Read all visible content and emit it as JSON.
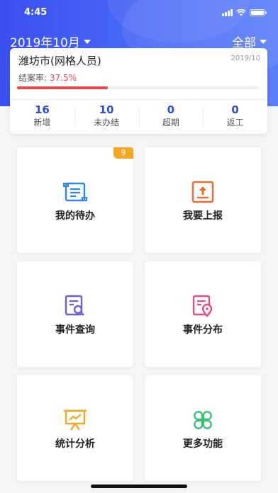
{
  "status_bar": {
    "time": "4:45"
  },
  "header": {
    "month": "2019年10月",
    "scope": "全部"
  },
  "summary": {
    "title": "潍坊市(网格人员)",
    "date": "2019/10",
    "rate_label": "结案率:",
    "rate_value": "37.5%",
    "rate_fraction": 0.375,
    "stats": [
      {
        "value": "16",
        "label": "新增"
      },
      {
        "value": "10",
        "label": "未办结"
      },
      {
        "value": "0",
        "label": "超期"
      },
      {
        "value": "0",
        "label": "返工"
      }
    ]
  },
  "tiles": [
    {
      "label": "我的待办",
      "icon": "scroll-list-icon",
      "color": "#2f86e8",
      "badge": "9"
    },
    {
      "label": "我要上报",
      "icon": "upload-icon",
      "color": "#ef6c2f"
    },
    {
      "label": "事件查询",
      "icon": "document-search-icon",
      "color": "#6b5cd8"
    },
    {
      "label": "事件分布",
      "icon": "document-location-icon",
      "color": "#e84a8a"
    },
    {
      "label": "统计分析",
      "icon": "presentation-chart-icon",
      "color": "#f5a623"
    },
    {
      "label": "更多功能",
      "icon": "clover-icon",
      "color": "#3bbf73"
    }
  ],
  "colors": {
    "primary": "#3a4ff0",
    "rate": "#e5484d",
    "stat_number": "#2d4bd6"
  }
}
